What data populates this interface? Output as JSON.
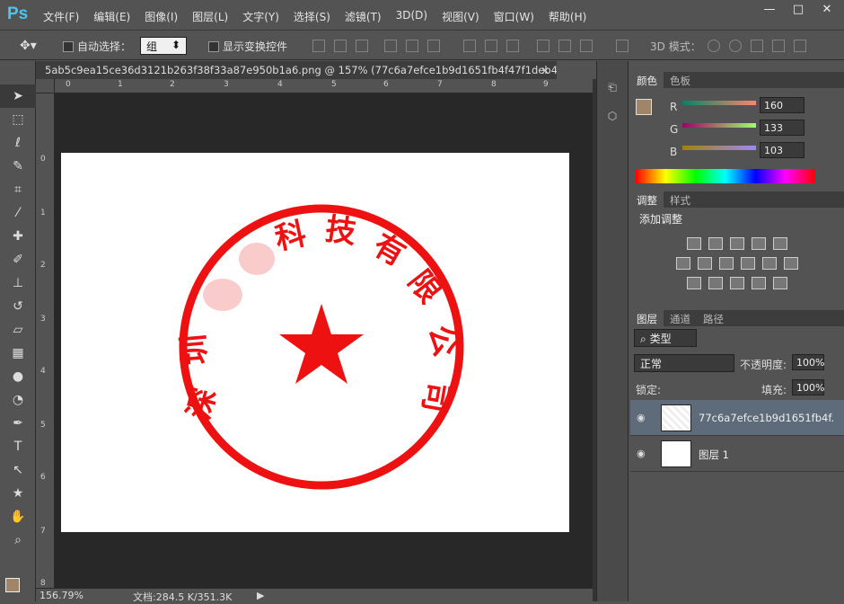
{
  "app": {
    "logo": "Ps"
  },
  "menu": [
    "文件(F)",
    "编辑(E)",
    "图像(I)",
    "图层(L)",
    "文字(Y)",
    "选择(S)",
    "滤镜(T)",
    "3D(D)",
    "视图(V)",
    "窗口(W)",
    "帮助(H)"
  ],
  "window_controls": {
    "minimize": "—",
    "maximize": "□",
    "close": "✕"
  },
  "options": {
    "auto_select_label": "自动选择：",
    "auto_select_value": "组",
    "show_transform_label": "显示变换控件",
    "mode_3d_label": "3D 模式："
  },
  "document": {
    "tab_title": "5ab5c9ea15ce36d3121b263f38f33a87e950b1a6.png @ 157% (77c6a7efce1b9d1651fb4f47f1deb4..."
  },
  "ruler": {
    "h_ticks": [
      "0",
      "1",
      "2",
      "3",
      "4",
      "5",
      "6",
      "7",
      "8",
      "9"
    ],
    "v_ticks": [
      "0",
      "1",
      "2",
      "3",
      "4",
      "5",
      "6",
      "7",
      "8"
    ]
  },
  "stamp": {
    "arc_text": [
      "深",
      "圳",
      "科",
      "技",
      "有",
      "限",
      "公",
      "司"
    ],
    "color": "#ee1111"
  },
  "status": {
    "zoom": "156.79%",
    "doc_size": "文档:284.5 K/351.3K"
  },
  "color_panel": {
    "tabs": [
      "颜色",
      "色板"
    ],
    "r_label": "R",
    "g_label": "G",
    "b_label": "B",
    "r": "160",
    "g": "133",
    "b": "103",
    "swatch": "#a08567"
  },
  "adjust_panel": {
    "tabs": [
      "调整",
      "样式"
    ],
    "title": "添加调整"
  },
  "layers_panel": {
    "tabs": [
      "图层",
      "通道",
      "路径"
    ],
    "filter_label": "类型",
    "blend_mode": "正常",
    "opacity_label": "不透明度:",
    "opacity": "100%",
    "lock_label": "锁定:",
    "fill_label": "填充:",
    "fill": "100%",
    "layers": [
      {
        "name": "77c6a7efce1b9d1651fb4f..."
      },
      {
        "name": "图层 1"
      }
    ]
  }
}
